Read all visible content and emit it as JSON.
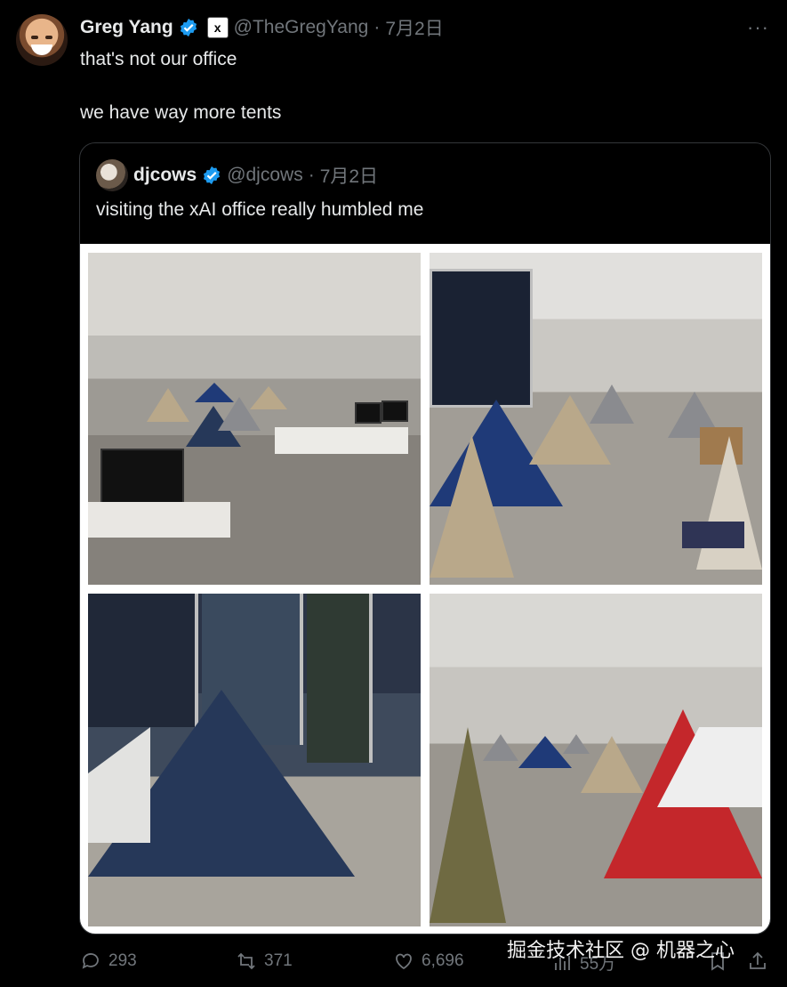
{
  "tweet": {
    "author_name": "Greg Yang",
    "affiliation_badge": "x",
    "handle": "@TheGregYang",
    "separator": "·",
    "date": "7月2日",
    "text": "that's not our office\n\nwe have way more tents",
    "more": "···"
  },
  "quoted": {
    "author_name": "djcows",
    "handle": "@djcows",
    "separator": "·",
    "date": "7月2日",
    "text": "visiting the xAI office really humbled me"
  },
  "actions": {
    "replies": "293",
    "reposts": "371",
    "likes": "6,696",
    "views": "55万"
  },
  "watermark": "掘金技术社区 @ 机器之心",
  "colors": {
    "background": "#000000",
    "verified": "#1d9bf0",
    "muted": "#71767b",
    "text": "#e7e9ea"
  }
}
